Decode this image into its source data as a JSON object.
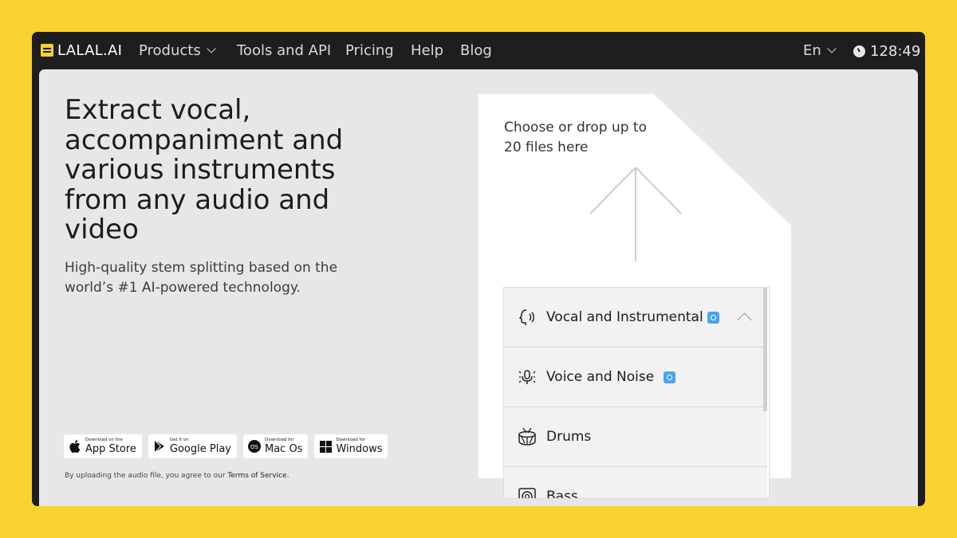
{
  "nav": {
    "logo_text": "LALAL.AI",
    "products": "Products",
    "tools": "Tools and API",
    "pricing": "Pricing",
    "help": "Help",
    "blog": "Blog",
    "language": "En",
    "timer": "128:49"
  },
  "hero": {
    "headline": "Extract vocal, accompaniment and various instruments from any audio and video",
    "subhead": "High-quality stem splitting based on the world’s #1 AI-powered technology."
  },
  "stores": [
    {
      "small": "Download on the",
      "big": "App Store",
      "icon": "apple-icon"
    },
    {
      "small": "Get it on",
      "big": "Google Play",
      "icon": "google-play-icon"
    },
    {
      "small": "Download for",
      "big": "Mac Os",
      "icon": "macos-icon"
    },
    {
      "small": "Download for",
      "big": "Windows",
      "icon": "windows-icon"
    }
  ],
  "terms": {
    "prefix": "By uploading the audio file, you agree to our",
    "link": "Terms of Service."
  },
  "dropzone": {
    "text": "Choose or drop up to 20 files here"
  },
  "stems": [
    {
      "label": "Vocal and Instrumental",
      "icon": "voice-head-icon",
      "badge": true
    },
    {
      "label": "Voice and Noise",
      "icon": "microphone-noise-icon",
      "badge": true
    },
    {
      "label": "Drums",
      "icon": "drum-icon",
      "badge": false
    },
    {
      "label": "Bass",
      "icon": "bass-speaker-icon",
      "badge": false
    }
  ],
  "colors": {
    "background": "#f8d330",
    "window": "#1f1e1e",
    "content": "#e7e7e7",
    "badge": "#4aa3f5"
  }
}
